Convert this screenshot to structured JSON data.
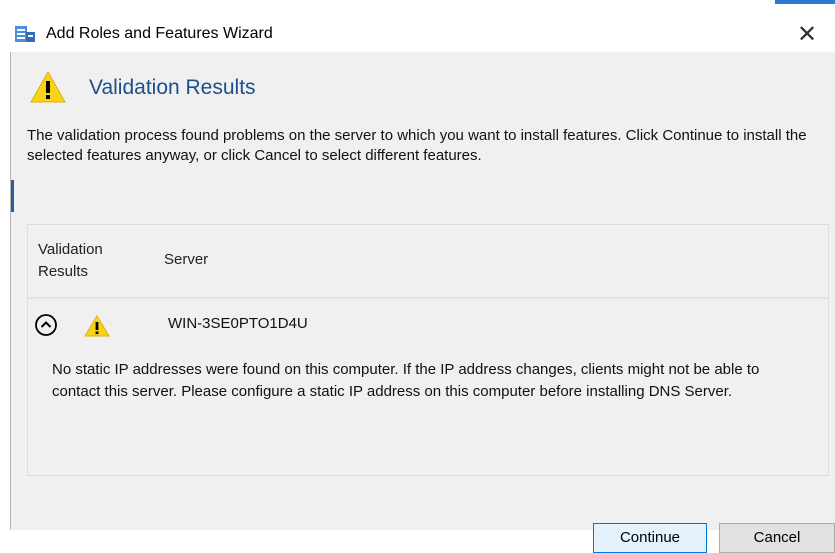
{
  "window": {
    "title": "Add Roles and Features Wizard",
    "close_glyph": "✕",
    "app_icon": "server-manager-icon"
  },
  "header": {
    "icon": "warning-icon",
    "title": "Validation Results"
  },
  "description": "The validation process found problems on the server to which you want to install features. Click Continue to install the selected features anyway, or click Cancel to select different features.",
  "grid": {
    "columns": [
      "Validation Results",
      "Server"
    ],
    "rows": [
      {
        "expanded": true,
        "status_icon": "warning-icon",
        "server": "WIN-3SE0PTO1D4U",
        "message": "No static IP addresses were found on this computer. If the IP address changes, clients might not be able to contact this server. Please configure a static IP address on this computer before installing DNS Server."
      }
    ]
  },
  "buttons": {
    "continue": "Continue",
    "cancel": "Cancel"
  },
  "colors": {
    "heading": "#1e4e8c",
    "warning_fill": "#f9d21c",
    "window_bg": "#f0f0f0",
    "default_button_border": "#0078d7"
  }
}
